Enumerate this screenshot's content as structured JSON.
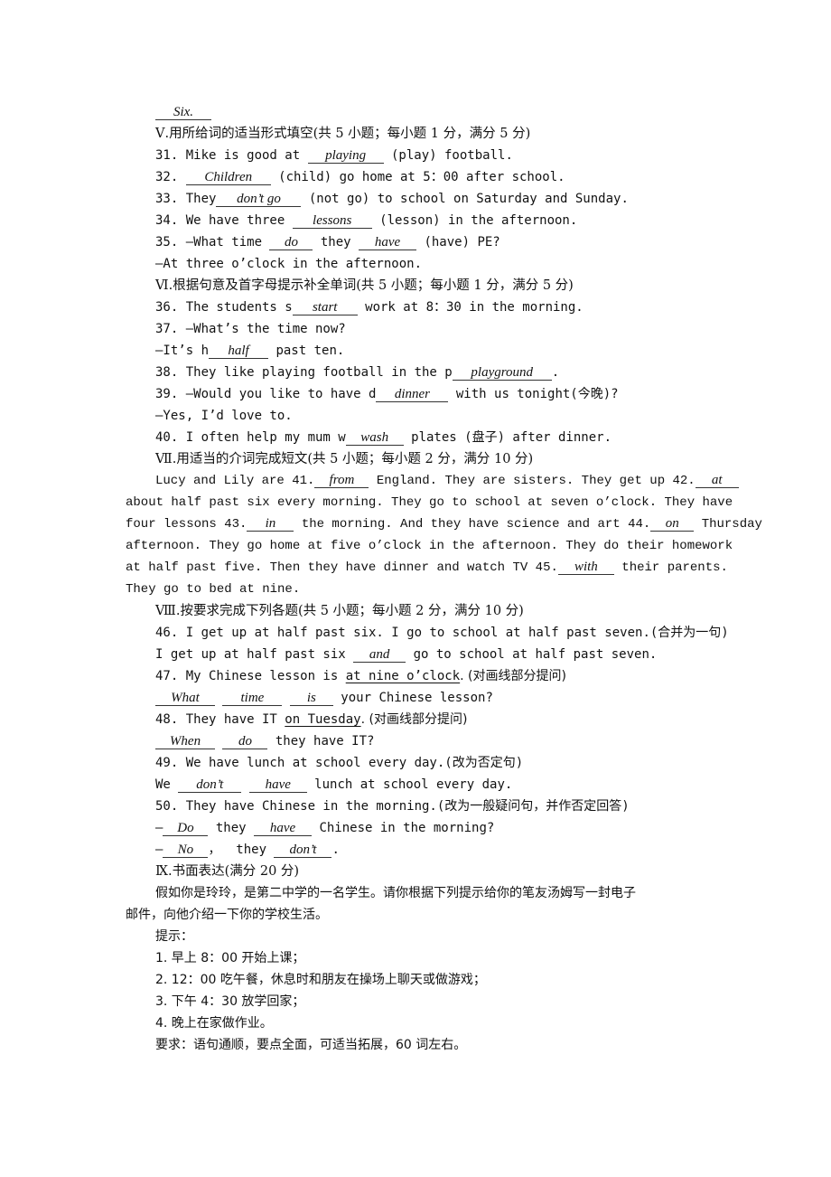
{
  "prev_answer": "Six.",
  "section5": {
    "heading": "Ⅴ.用所给词的适当形式填空(共 5 小题；每小题 1 分，满分 5 分)",
    "q31": {
      "pre": "31. Mike is good at ",
      "answer": "playing",
      "post": " (play) football."
    },
    "q32": {
      "pre": "32. ",
      "answer": "Children",
      "post": " (child) go home at 5：00 after school."
    },
    "q33": {
      "pre": "33. They",
      "answer": "don’t go",
      "post": " (not go) to school on Saturday and Sunday."
    },
    "q34": {
      "pre": "34. We have three ",
      "answer": "lessons",
      "post": " (lesson) in the afternoon."
    },
    "q35": {
      "pre": "35. —What time ",
      "answer1": "do",
      "mid": " they ",
      "answer2": "have",
      "post": " (have) PE?",
      "reply": "—At three o’clock in the afternoon."
    }
  },
  "section6": {
    "heading": "Ⅵ.根据句意及首字母提示补全单词(共 5 小题；每小题 1 分，满分 5 分)",
    "q36": {
      "pre": "36. The students s",
      "answer": "start",
      "post": " work at 8：30 in the morning."
    },
    "q37": {
      "line1": "37. —What’s the time now?",
      "pre": "—It’s h",
      "answer": "half",
      "post": " past ten."
    },
    "q38": {
      "pre": "38. They like playing football in the p",
      "answer": "playground",
      "post": "."
    },
    "q39": {
      "pre": "39. —Would you like to have d",
      "answer": "dinner",
      "post": " with us tonight(今晚)?",
      "reply": "—Yes, I’d love to."
    },
    "q40": {
      "pre": "40. I often help my mum w",
      "answer": "wash",
      "post": " plates (盘子) after dinner."
    }
  },
  "section7": {
    "heading": "Ⅶ.用适当的介词完成短文(共 5 小题；每小题 2 分，满分 10 分)",
    "l1_pre": "Lucy and Lily are 41.",
    "a41": "from",
    "l1_mid": " England. They are sisters. They get up 42.",
    "a42": "at",
    "l2": "about half past six every morning. They go to school at seven o’clock. They have",
    "l3_pre": "four lessons 43.",
    "a43": "in",
    "l3_mid": " the morning. And they have science and art 44.",
    "a44": "on",
    "l3_post": " Thursday",
    "l4": "afternoon. They go home at five o’clock in the afternoon. They do their homework",
    "l5_pre": "at half past five. Then they have dinner and watch TV 45.",
    "a45": "with",
    "l5_post": " their parents.",
    "l6": "They go to bed at nine."
  },
  "section8": {
    "heading": "Ⅷ.按要求完成下列各题(共 5 小题；每小题 2 分，满分 10 分)",
    "q46": {
      "prompt": "46. I get up at half past six. I go to school at half past seven.(合并为一句)",
      "pre": "I get up at half past six ",
      "answer": "and",
      "post": " go to school at half past seven."
    },
    "q47": {
      "pre": "47. My Chinese lesson is ",
      "underlined": "at nine o’clock",
      "post": ". (对画线部分提问)",
      "a1": "What",
      "a2": "time",
      "a3": "is",
      "tail": " your Chinese lesson?"
    },
    "q48": {
      "pre": "48. They have IT ",
      "underlined": "on Tuesday",
      "post": ". (对画线部分提问)",
      "a1": "When",
      "a2": "do",
      "tail": " they have IT?"
    },
    "q49": {
      "prompt": "49. We have lunch at school every day.(改为否定句)",
      "pre": "We ",
      "a1": "don’t",
      "a2": "have",
      "tail": " lunch at school every day."
    },
    "q50": {
      "prompt": "50. They have Chinese in the morning.(改为一般疑问句，并作否定回答)",
      "dash": "—",
      "a1": "Do",
      "mid1": " they ",
      "a2": "have",
      "tail1": " Chinese in the morning?",
      "a3": "No",
      "mid2": "，  they ",
      "a4": "don’t",
      "tail2": "."
    }
  },
  "section9": {
    "heading": "Ⅸ.书面表达(满分 20 分)",
    "intro1": "假如你是玲玲，是第二中学的一名学生。请你根据下列提示给你的笔友汤姆写一封电子",
    "intro2": "邮件，向他介绍一下你的学校生活。",
    "hint_label": "提示：",
    "hints": [
      "1. 早上 8：00 开始上课；",
      "2. 12：00 吃午餐，休息时和朋友在操场上聊天或做游戏；",
      "3. 下午 4：30 放学回家；",
      "4. 晚上在家做作业。"
    ],
    "requirement": "要求：语句通顺，要点全面，可适当拓展，60 词左右。"
  }
}
